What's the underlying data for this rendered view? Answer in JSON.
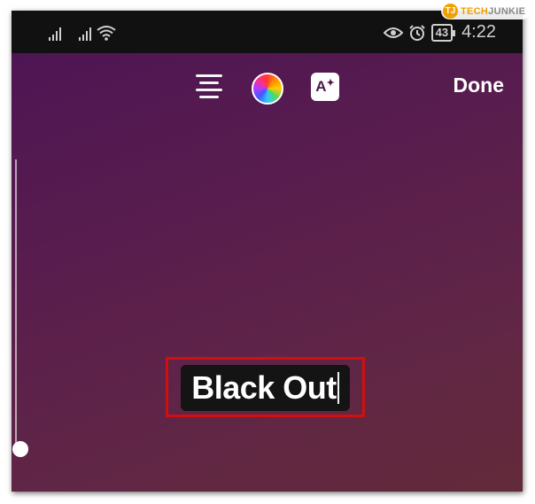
{
  "status_bar": {
    "battery": "43",
    "time": "4:22"
  },
  "toolbar": {
    "align_icon": "align-center-icon",
    "color_icon": "color-wheel-icon",
    "effects_icon": "text-effects-icon",
    "effects_label": "A",
    "done_label": "Done"
  },
  "editor": {
    "text": "Black Out",
    "text_background": "#141414",
    "text_color": "#ffffff"
  },
  "watermark": {
    "logo": "TJ",
    "brand_a": "TECH",
    "brand_b": "JUNKIE"
  },
  "colors": {
    "highlight_border": "#d01010",
    "background_top": "#4e1554",
    "background_bottom": "#632a3a"
  }
}
